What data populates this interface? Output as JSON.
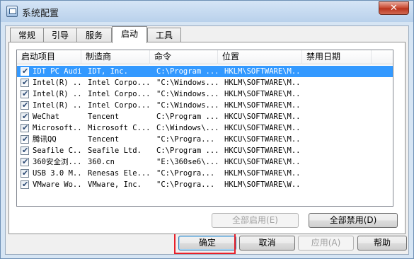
{
  "window": {
    "title": "系统配置",
    "close_glyph": "✕"
  },
  "tabs": [
    {
      "label": "常规",
      "active": false
    },
    {
      "label": "引导",
      "active": false
    },
    {
      "label": "服务",
      "active": false
    },
    {
      "label": "启动",
      "active": true
    },
    {
      "label": "工具",
      "active": false
    }
  ],
  "columns": [
    "启动项目",
    "制造商",
    "命令",
    "位置",
    "禁用日期"
  ],
  "rows": [
    {
      "item": "IDT PC Audio",
      "maker": "IDT, Inc.",
      "command": "C:\\Program ...",
      "location": "HKLM\\SOFTWARE\\M...",
      "date": "",
      "checked": true,
      "selected": true
    },
    {
      "item": "Intel(R) ...",
      "maker": "Intel Corpo...",
      "command": "\"C:\\Windows...",
      "location": "HKLM\\SOFTWARE\\M...",
      "date": "",
      "checked": true,
      "selected": false
    },
    {
      "item": "Intel(R) ...",
      "maker": "Intel Corpo...",
      "command": "\"C:\\Windows...",
      "location": "HKLM\\SOFTWARE\\M...",
      "date": "",
      "checked": true,
      "selected": false
    },
    {
      "item": "Intel(R) ...",
      "maker": "Intel Corpo...",
      "command": "\"C:\\Windows...",
      "location": "HKLM\\SOFTWARE\\M...",
      "date": "",
      "checked": true,
      "selected": false
    },
    {
      "item": "WeChat",
      "maker": "Tencent",
      "command": "C:\\Program ...",
      "location": "HKCU\\SOFTWARE\\M...",
      "date": "",
      "checked": true,
      "selected": false
    },
    {
      "item": "Microsoft...",
      "maker": "Microsoft C...",
      "command": "C:\\Windows\\...",
      "location": "HKCU\\SOFTWARE\\M...",
      "date": "",
      "checked": true,
      "selected": false
    },
    {
      "item": "腾讯QQ",
      "maker": "Tencent",
      "command": "\"C:\\Progra...",
      "location": "HKCU\\SOFTWARE\\M...",
      "date": "",
      "checked": true,
      "selected": false
    },
    {
      "item": "Seafile C...",
      "maker": "Seafile Ltd.",
      "command": "C:\\Program ...",
      "location": "HKCU\\SOFTWARE\\M...",
      "date": "",
      "checked": true,
      "selected": false
    },
    {
      "item": "360安全浏...",
      "maker": "360.cn",
      "command": "\"E:\\360se6\\...",
      "location": "HKCU\\SOFTWARE\\M...",
      "date": "",
      "checked": true,
      "selected": false
    },
    {
      "item": "USB 3.0 M...",
      "maker": "Renesas Ele...",
      "command": "\"C:\\Progra...",
      "location": "HKLM\\SOFTWARE\\M...",
      "date": "",
      "checked": true,
      "selected": false
    },
    {
      "item": "VMware Wo...",
      "maker": "VMware, Inc.",
      "command": "\"C:\\Progra...",
      "location": "HKLM\\SOFTWARE\\W...",
      "date": "",
      "checked": true,
      "selected": false
    }
  ],
  "panel_buttons": {
    "enable_all": "全部启用(E)",
    "disable_all": "全部禁用(D)"
  },
  "dialog_buttons": {
    "ok": "确定",
    "cancel": "取消",
    "apply": "应用(A)",
    "help": "帮助"
  },
  "colors": {
    "selection": "#3399ff",
    "highlight_box": "#e8202a"
  }
}
